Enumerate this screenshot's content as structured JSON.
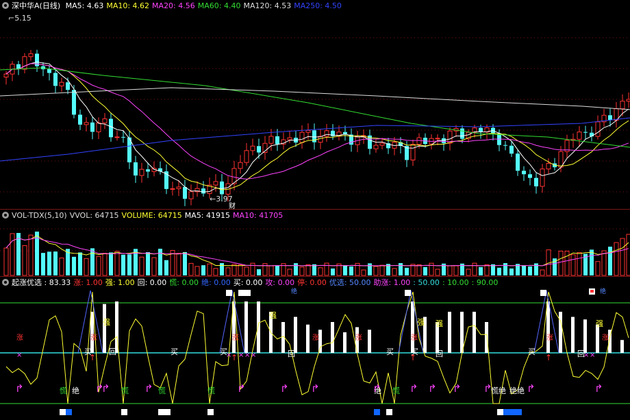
{
  "price_header": {
    "name": "深中华A(日线)",
    "items": [
      {
        "label": "MA5: 4.63",
        "color": "#ffffff"
      },
      {
        "label": "MA10: 4.62",
        "color": "#ffff33"
      },
      {
        "label": "MA20: 4.56",
        "color": "#ff44ff"
      },
      {
        "label": "MA60: 4.40",
        "color": "#33dd33"
      },
      {
        "label": "MA120: 4.53",
        "color": "#dddddd"
      },
      {
        "label": "MA250: 4.50",
        "color": "#3344ff"
      }
    ]
  },
  "price_annotations": {
    "high": "5.15",
    "low": "3.97",
    "fin": "财"
  },
  "vol_header": {
    "items": [
      {
        "label": "VOL-TDX(5,10)",
        "color": "#dddddd"
      },
      {
        "label": "VVOL: 64715",
        "color": "#dddddd"
      },
      {
        "label": "VOLUME: 64715",
        "color": "#ffff33"
      },
      {
        "label": "MA5: 41915",
        "color": "#ffffff"
      },
      {
        "label": "MA10: 41705",
        "color": "#ff44ff"
      }
    ]
  },
  "ind_header": {
    "items": [
      {
        "label": "起涨优选 : 83.33",
        "color": "#ffffff"
      },
      {
        "label": "涨: 1.00",
        "color": "#ff3333"
      },
      {
        "label": "强: 1.00",
        "color": "#ffff33"
      },
      {
        "label": "回: 0.00",
        "color": "#ffffff"
      },
      {
        "label": "慌: 0.00",
        "color": "#33dd33"
      },
      {
        "label": "绝: 0.00",
        "color": "#3366ff"
      },
      {
        "label": "买: 0.00",
        "color": "#ffffff"
      },
      {
        "label": "攻: 0.00",
        "color": "#ff44ff"
      },
      {
        "label": "停: 0.00",
        "color": "#ff3333"
      },
      {
        "label": "优选: 50.00",
        "color": "#5588ff"
      },
      {
        "label": "助涨: 1.00",
        "color": "#ff44ff"
      },
      {
        "label": ": 50.00",
        "color": "#33dddd"
      },
      {
        "label": ": 10.00",
        "color": "#33dd33"
      },
      {
        "label": ": 90.00",
        "color": "#33dd33"
      }
    ]
  },
  "signal_labels": {
    "buy": "买",
    "panic": "慌",
    "despair": "绝",
    "back": "回",
    "strong": "强",
    "rise": "涨",
    "panic_despair": "慌绝",
    "despair_despair": "绝绝",
    "blue_tag": "绝"
  },
  "colors": {
    "up": "#ff3232",
    "down": "#54fcfc",
    "bg": "#000000",
    "grid": "#7a1515"
  }
}
